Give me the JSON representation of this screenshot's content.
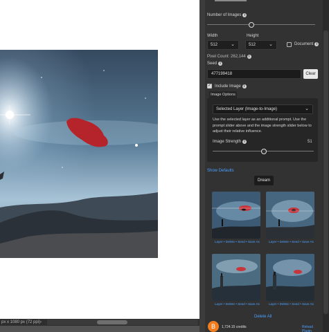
{
  "canvas": {
    "status_text": "px x 1080 px (72 ppi)",
    "status_arrow": "›"
  },
  "panel": {
    "number_of_images": {
      "label": "Number of Images",
      "info_icon": "i"
    },
    "width": {
      "label": "Width",
      "value": "512"
    },
    "height": {
      "label": "Height",
      "value": "512"
    },
    "document_checkbox": {
      "label": "Document",
      "checked": false
    },
    "pixel_count": "Pixel Count: 262,144",
    "seed": {
      "label": "Seed",
      "value": "477199418",
      "clear_label": "Clear"
    },
    "include_image": {
      "label": "Include Image",
      "checked": true
    },
    "image_options": {
      "tab_label": "Image Options",
      "layer_select": "Selected Layer (Image-to-Image)",
      "description": "Use the selected layer as an additional prompt. Use the prompt slider above and the image strength slider below to adjust their relative influence.",
      "strength_label": "Image Strength",
      "strength_value": "51",
      "strength_fraction": 0.51
    },
    "show_defaults": "Show Defaults",
    "dream_label": "Dream",
    "thumbnails": [
      {
        "actions": "Layer • Delete • Seed • Save As"
      },
      {
        "actions": "Layer • Delete • Seed • Save As"
      },
      {
        "actions": "Layer • Delete • Seed • Save As"
      },
      {
        "actions": "Layer • Delete • Seed • Save As"
      }
    ],
    "delete_all": "Delete All",
    "footer": {
      "avatar_letter": "B",
      "credits": "1,724.15 credits",
      "reload_plugin": "Reload Plugin"
    }
  },
  "colors": {
    "panel_bg": "#323232",
    "link": "#4aa0ff",
    "avatar": "#f07c1e"
  }
}
